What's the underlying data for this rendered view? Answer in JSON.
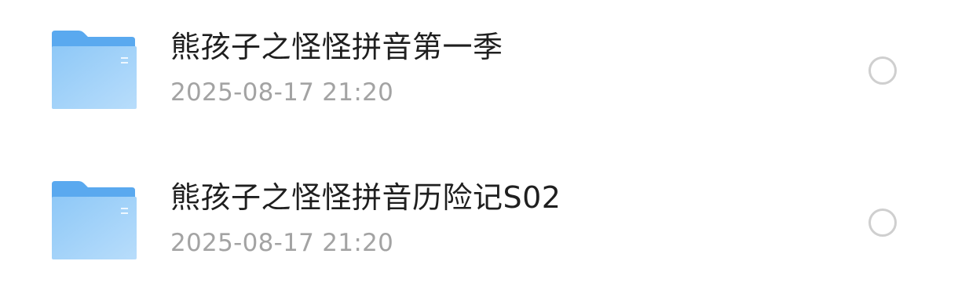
{
  "files": [
    {
      "icon": "folder-icon",
      "name": "熊孩子之怪怪拼音第一季",
      "date": "2025-08-17 21:20",
      "selected": false
    },
    {
      "icon": "folder-icon",
      "name": "熊孩子之怪怪拼音历险记S02",
      "date": "2025-08-17 21:20",
      "selected": false
    }
  ],
  "colors": {
    "folder_back": "#5aa9ef",
    "folder_front_start": "#8ec8f7",
    "folder_front_end": "#b6dcfb",
    "title_text": "#1f1f1f",
    "date_text": "#a3a3a3",
    "radio_border": "#cfcfcf"
  }
}
